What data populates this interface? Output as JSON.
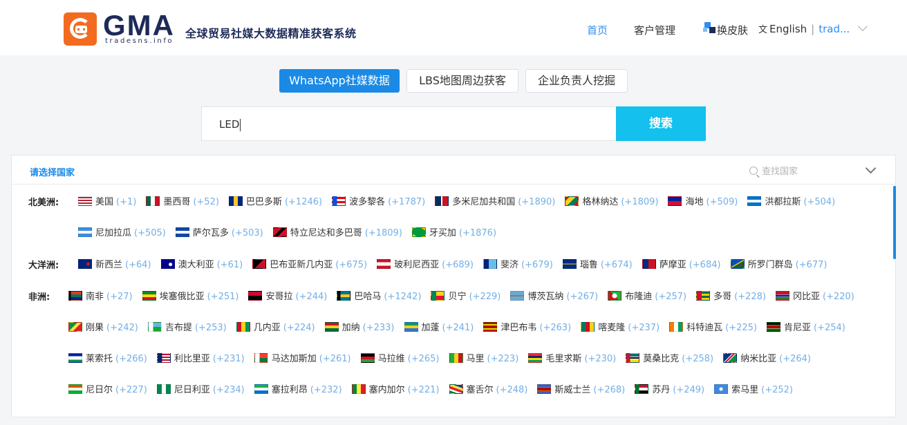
{
  "header": {
    "brand": "GMA",
    "brand_sub": "tradesns.info",
    "slogan": "全球贸易社媒大数据精准获客系统",
    "nav": {
      "home": "首页",
      "customers": "客户管理"
    },
    "skin_label": "换皮肤",
    "language": "English",
    "separator": "|",
    "user": "trad..."
  },
  "tabs": [
    {
      "label": "WhatsApp社媒数据",
      "active": true
    },
    {
      "label": "LBS地图周边获客",
      "active": false
    },
    {
      "label": "企业负责人挖掘",
      "active": false
    }
  ],
  "search": {
    "value": "LED",
    "button_label": "搜索"
  },
  "country_panel": {
    "title": "请选择国家",
    "find_placeholder": "查找国家",
    "regions": [
      {
        "name": "北美洲:",
        "rows": [
          [
            {
              "name": "美国",
              "count": "(+1)",
              "flag": "us"
            },
            {
              "name": "墨西哥",
              "count": "(+52)",
              "flag": "mx"
            },
            {
              "name": "巴巴多斯",
              "count": "(+1246)",
              "flag": "bb"
            },
            {
              "name": "波多黎各",
              "count": "(+1787)",
              "flag": "pr"
            },
            {
              "name": "多米尼加共和国",
              "count": "(+1890)",
              "flag": "do"
            },
            {
              "name": "格林纳达",
              "count": "(+1809)",
              "flag": "gd"
            },
            {
              "name": "海地",
              "count": "(+509)",
              "flag": "ht"
            },
            {
              "name": "洪都拉斯",
              "count": "(+504)",
              "flag": "hn"
            }
          ],
          [
            {
              "name": "尼加拉瓜",
              "count": "(+505)",
              "flag": "ni"
            },
            {
              "name": "萨尔瓦多",
              "count": "(+503)",
              "flag": "sv"
            },
            {
              "name": "特立尼达和多巴哥",
              "count": "(+1809)",
              "flag": "tt"
            },
            {
              "name": "牙买加",
              "count": "(+1876)",
              "flag": "jm"
            }
          ]
        ]
      },
      {
        "name": "大洋洲:",
        "rows": [
          [
            {
              "name": "新西兰",
              "count": "(+64)",
              "flag": "nz"
            },
            {
              "name": "澳大利亚",
              "count": "(+61)",
              "flag": "au"
            },
            {
              "name": "巴布亚新几内亚",
              "count": "(+675)",
              "flag": "pg"
            },
            {
              "name": "玻利尼西亚",
              "count": "(+689)",
              "flag": "pf"
            },
            {
              "name": "斐济",
              "count": "(+679)",
              "flag": "fj"
            },
            {
              "name": "瑙鲁",
              "count": "(+674)",
              "flag": "nr"
            },
            {
              "name": "萨摩亚",
              "count": "(+684)",
              "flag": "ws"
            },
            {
              "name": "所罗门群岛",
              "count": "(+677)",
              "flag": "sb"
            }
          ]
        ]
      },
      {
        "name": "非洲:",
        "rows": [
          [
            {
              "name": "南非",
              "count": "(+27)",
              "flag": "za"
            },
            {
              "name": "埃塞俄比亚",
              "count": "(+251)",
              "flag": "et"
            },
            {
              "name": "安哥拉",
              "count": "(+244)",
              "flag": "ao"
            },
            {
              "name": "巴哈马",
              "count": "(+1242)",
              "flag": "bs"
            },
            {
              "name": "贝宁",
              "count": "(+229)",
              "flag": "bj"
            },
            {
              "name": "博茨瓦纳",
              "count": "(+267)",
              "flag": "bw"
            },
            {
              "name": "布隆迪",
              "count": "(+257)",
              "flag": "bi"
            },
            {
              "name": "多哥",
              "count": "(+228)",
              "flag": "tg"
            },
            {
              "name": "冈比亚",
              "count": "(+220)",
              "flag": "gm"
            }
          ],
          [
            {
              "name": "刚果",
              "count": "(+242)",
              "flag": "cg"
            },
            {
              "name": "吉布提",
              "count": "(+253)",
              "flag": "dj"
            },
            {
              "name": "几内亚",
              "count": "(+224)",
              "flag": "gn"
            },
            {
              "name": "加纳",
              "count": "(+233)",
              "flag": "gh"
            },
            {
              "name": "加蓬",
              "count": "(+241)",
              "flag": "ga"
            },
            {
              "name": "津巴布韦",
              "count": "(+263)",
              "flag": "zw"
            },
            {
              "name": "喀麦隆",
              "count": "(+237)",
              "flag": "cm"
            },
            {
              "name": "科特迪瓦",
              "count": "(+225)",
              "flag": "ci"
            },
            {
              "name": "肯尼亚",
              "count": "(+254)",
              "flag": "ke"
            }
          ],
          [
            {
              "name": "莱索托",
              "count": "(+266)",
              "flag": "ls"
            },
            {
              "name": "利比里亚",
              "count": "(+231)",
              "flag": "lr"
            },
            {
              "name": "马达加斯加",
              "count": "(+261)",
              "flag": "mg"
            },
            {
              "name": "马拉维",
              "count": "(+265)",
              "flag": "mw"
            },
            {
              "name": "马里",
              "count": "(+223)",
              "flag": "ml"
            },
            {
              "name": "毛里求斯",
              "count": "(+230)",
              "flag": "mu"
            },
            {
              "name": "莫桑比克",
              "count": "(+258)",
              "flag": "mz"
            },
            {
              "name": "纳米比亚",
              "count": "(+264)",
              "flag": "na"
            }
          ],
          [
            {
              "name": "尼日尔",
              "count": "(+227)",
              "flag": "ne"
            },
            {
              "name": "尼日利亚",
              "count": "(+234)",
              "flag": "ng"
            },
            {
              "name": "塞拉利昂",
              "count": "(+232)",
              "flag": "sl"
            },
            {
              "name": "塞内加尔",
              "count": "(+221)",
              "flag": "sn"
            },
            {
              "name": "塞舌尔",
              "count": "(+248)",
              "flag": "sc"
            },
            {
              "name": "斯威士兰",
              "count": "(+268)",
              "flag": "sz"
            },
            {
              "name": "苏丹",
              "count": "(+249)",
              "flag": "sd"
            },
            {
              "name": "索马里",
              "count": "(+252)",
              "flag": "so"
            }
          ]
        ]
      }
    ]
  },
  "colors": {
    "accent": "#1a8ae6",
    "search_button": "#14c0ed",
    "logo": "#f26b21",
    "brand": "#1d2b58"
  }
}
